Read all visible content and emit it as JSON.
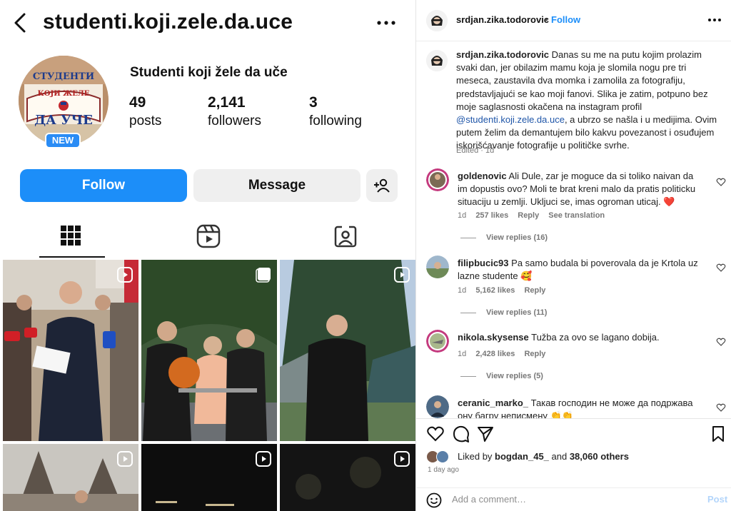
{
  "profile": {
    "username": "studenti.koji.zele.da.uce",
    "display_name": "Studenti koji žele da uče",
    "avatar": {
      "line1": "СТУДЕНТИ",
      "line2": "КОЈИ ЖЕЛЕ",
      "line3": "ДА УЧЕ"
    },
    "badge": "NEW",
    "stats": [
      {
        "value": "49",
        "label": "posts"
      },
      {
        "value": "2,141",
        "label": "followers"
      },
      {
        "value": "3",
        "label": "following"
      }
    ],
    "follow_label": "Follow",
    "message_label": "Message",
    "tabs": [
      "grid-icon",
      "reels-icon",
      "tagged-icon"
    ]
  },
  "post": {
    "author": "srdjan.zika.todorovic",
    "separator": "•",
    "follow_label": "Follow",
    "caption_user": "srdjan.zika.todorovic",
    "caption_part1": " Danas su me na putu kojim prolazim svaki dan, jer obilazim mamu koja je slomila nogu pre tri meseca, zaustavila dva momka i zamolila za fotografiju, predstavljajući se kao moji fanovi. Slika je zatim, potpuno bez moje saglasnosti okačena na instagram profil ",
    "caption_mention": "@studenti.koji.zele.da.uce",
    "caption_part2": ", a ubrzo se našla i u medijima. Ovim putem želim da demantujem bilo kakvu povezanost i osuđujem iskorišćavanje fotografije u političke svrhe.",
    "edited": "Edited · 1d",
    "comments": [
      {
        "user": "goldenovic",
        "text": " Ali Dule, zar je moguce da si toliko naivan da im dopustis ovo? Moli te brat kreni malo da pratis politicku situaciju u zemlji. Ukljuci se, imas ogroman uticaj. ❤️",
        "age": "1d",
        "likes": "257 likes",
        "reply": "Reply",
        "translate": "See translation",
        "replies": "View replies (16)"
      },
      {
        "user": "filipbucic93",
        "text": " Pa samo budala bi poverovala da je Krtola uz lazne studente 🥰",
        "age": "1d",
        "likes": "5,162 likes",
        "reply": "Reply",
        "replies": "View replies (11)"
      },
      {
        "user": "nikola.skysense",
        "text": " Tužba za ovo se lagano dobija.",
        "age": "1d",
        "likes": "2,428 likes",
        "reply": "Reply",
        "replies": "View replies (5)"
      },
      {
        "user": "ceranic_marko_",
        "text": " Такав господин не може да подржава ону багру неписмену 👏👏"
      }
    ],
    "liked_prefix": "Liked by ",
    "liked_user": "bogdan_45_",
    "liked_mid": " and ",
    "liked_count": "38,060 others",
    "time_ago": "1 day ago",
    "add_comment_placeholder": "Add a comment…",
    "post_label": "Post"
  },
  "colors": {
    "accent": "#1c8ef9",
    "heart": "#e0245e"
  }
}
